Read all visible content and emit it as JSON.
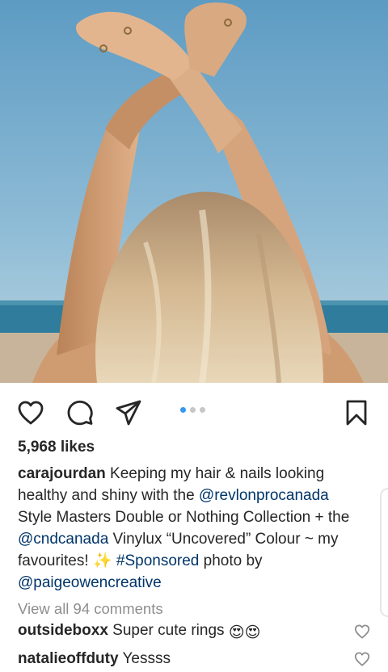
{
  "post": {
    "image_alt": "woman with blonde hair raising crossed arms against blue sky",
    "carousel": {
      "count": 3,
      "active_index": 0
    },
    "likes": "5,968 likes",
    "caption": {
      "username": "carajourdan",
      "text_1": " Keeping my hair & nails looking healthy and shiny with the ",
      "mention_1": "@revlonprocanada",
      "text_2": " Style Masters Double or Nothing Collection + the ",
      "mention_2": "@cndcanada",
      "text_3": " Vinylux “Uncovered” Colour ~ my favourites! ",
      "sparkle": "✨",
      "hashtag": "#Sponsored",
      "text_4": " photo by ",
      "mention_3": "@paigeowencreative"
    },
    "view_all_comments": "View all 94 comments",
    "comments": [
      {
        "username": "outsideboxx",
        "text": " Super cute rings",
        "emoji": "😍😍"
      },
      {
        "username": "natalieoffduty",
        "text": " Yessss"
      }
    ]
  },
  "icons": {
    "like": "heart-icon",
    "comment": "comment-icon",
    "share": "send-icon",
    "save": "bookmark-icon"
  },
  "colors": {
    "link": "#003569",
    "carousel_active": "#3897f0",
    "carousel_inactive": "#c7c7c7",
    "muted_text": "#8e8e8e",
    "text": "#262626"
  }
}
